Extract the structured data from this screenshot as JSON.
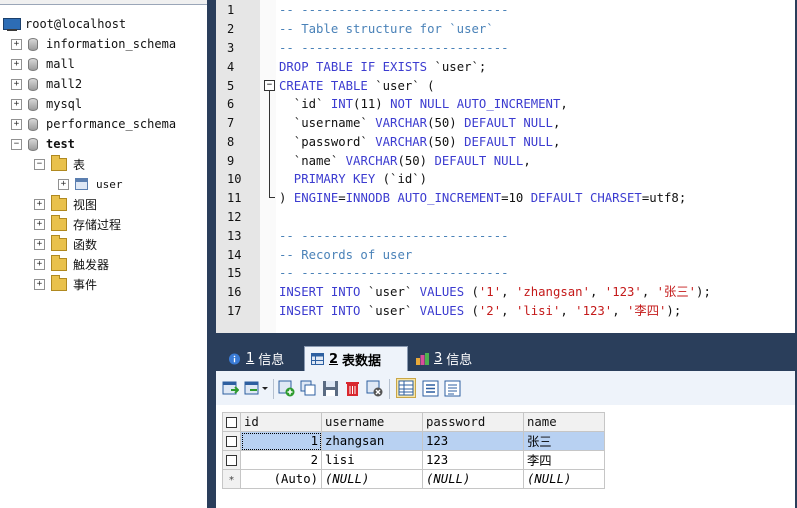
{
  "tree": {
    "host": "root@localhost",
    "databases": [
      {
        "name": "information_schema",
        "expander": "+"
      },
      {
        "name": "mall",
        "expander": "+"
      },
      {
        "name": "mall2",
        "expander": "+"
      },
      {
        "name": "mysql",
        "expander": "+"
      },
      {
        "name": "performance_schema",
        "expander": "+"
      },
      {
        "name": "test",
        "expander": "−"
      }
    ],
    "test_children": {
      "tables_folder": "表",
      "tables_expander": "−",
      "table_user": "user",
      "table_user_expander": "+",
      "folders": [
        "视图",
        "存储过程",
        "函数",
        "触发器",
        "事件"
      ],
      "folder_expander": "+"
    }
  },
  "editor": {
    "line_numbers": [
      "1",
      "2",
      "3",
      "4",
      "5",
      "6",
      "7",
      "8",
      "9",
      "10",
      "11",
      "12",
      "13",
      "14",
      "15",
      "16",
      "17"
    ],
    "fold_marker": "−",
    "lines": {
      "l1": "-- ----------------------------",
      "l2": "-- Table structure for `user`",
      "l3": "-- ----------------------------",
      "l4a": "DROP TABLE IF EXISTS ",
      "l4b": "`user`;",
      "l5a": "CREATE TABLE ",
      "l5b": "`user` (",
      "l6a": "  `id` ",
      "l6b": "INT",
      "l6c": "(11) ",
      "l6d": "NOT NULL AUTO_INCREMENT",
      "l6e": ",",
      "l7a": "  `username` ",
      "l7b": "VARCHAR",
      "l7c": "(50) ",
      "l7d": "DEFAULT NULL",
      "l7e": ",",
      "l8a": "  `password` ",
      "l8b": "VARCHAR",
      "l8c": "(50) ",
      "l8d": "DEFAULT NULL",
      "l8e": ",",
      "l9a": "  `name` ",
      "l9b": "VARCHAR",
      "l9c": "(50) ",
      "l9d": "DEFAULT NULL",
      "l9e": ",",
      "l10a": "  PRIMARY KEY ",
      "l10b": "(`id`)",
      "l11a": ") ",
      "l11b": "ENGINE",
      "l11c": "=",
      "l11d": "INNODB ",
      "l11e": "AUTO_INCREMENT",
      "l11f": "=10 ",
      "l11g": "DEFAULT CHARSET",
      "l11h": "=utf8;",
      "l13": "-- ----------------------------",
      "l14": "-- Records of user",
      "l15": "-- ----------------------------",
      "l16a": "INSERT INTO ",
      "l16b": "`user` ",
      "l16c": "VALUES ",
      "l16d": "(",
      "l16e": "'1'",
      "l16f": ", ",
      "l16g": "'zhangsan'",
      "l16h": ", ",
      "l16i": "'123'",
      "l16j": ", ",
      "l16k": "'张三'",
      "l16l": ");",
      "l17a": "INSERT INTO ",
      "l17b": "`user` ",
      "l17c": "VALUES ",
      "l17d": "(",
      "l17e": "'2'",
      "l17f": ", ",
      "l17g": "'lisi'",
      "l17h": ", ",
      "l17i": "'123'",
      "l17j": ", ",
      "l17k": "'李四'",
      "l17l": ");"
    }
  },
  "tabs": [
    {
      "num": "1",
      "label": "信息",
      "icon": "info-icon"
    },
    {
      "num": "2",
      "label": "表数据",
      "icon": "table-data-icon"
    },
    {
      "num": "3",
      "label": "信息",
      "icon": "profile-icon"
    }
  ],
  "grid": {
    "columns": [
      "id",
      "username",
      "password",
      "name"
    ],
    "rows": [
      {
        "id": "1",
        "username": "zhangsan",
        "password": "123",
        "name": "张三"
      },
      {
        "id": "2",
        "username": "lisi",
        "password": "123",
        "name": "李四"
      }
    ],
    "new_row": {
      "marker": "*",
      "id": "(Auto)",
      "username": "(NULL)",
      "password": "(NULL)",
      "name": "(NULL)"
    }
  },
  "colors": {
    "comment": "#4a82b8",
    "keyword": "#3c3cd0",
    "string": "#c41a1a",
    "dark_frame": "#2a3e5b",
    "row_highlight": "#b8d1f2"
  }
}
